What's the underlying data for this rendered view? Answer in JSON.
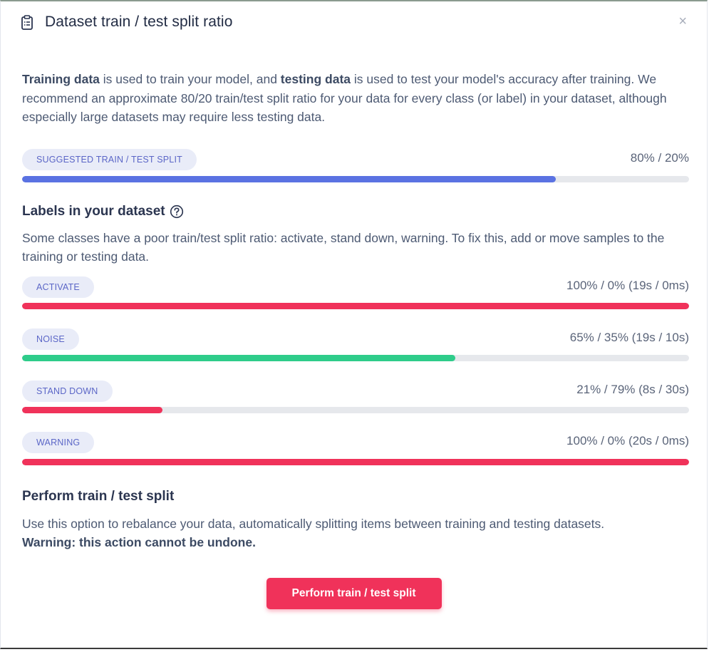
{
  "header": {
    "title": "Dataset train / test split ratio",
    "close_label": "×"
  },
  "intro": {
    "training_bold": "Training data",
    "text1": " is used to train your model, and ",
    "testing_bold": "testing data",
    "text2": " is used to test your model's accuracy after training. We recommend an approximate 80/20 train/test split ratio for your data for every class (or label) in your dataset, although especially large datasets may require less testing data."
  },
  "suggested": {
    "badge": "SUGGESTED TRAIN / TEST SPLIT",
    "ratio": "80% / 20%",
    "fill_fraction": 0.8,
    "color": "#5a72e2"
  },
  "labels_section": {
    "title": "Labels in your dataset",
    "description": "Some classes have a poor train/test split ratio: activate, stand down, warning. To fix this, add or move samples to the training or testing data.",
    "items": [
      {
        "label": "ACTIVATE",
        "ratio": "100% / 0% (19s / 0ms)",
        "fill_fraction": 1.0,
        "color": "#f0325a"
      },
      {
        "label": "NOISE",
        "ratio": "65% / 35% (19s / 10s)",
        "fill_fraction": 0.65,
        "color": "#2ecc8a"
      },
      {
        "label": "STAND DOWN",
        "ratio": "21% / 79% (8s / 30s)",
        "fill_fraction": 0.21,
        "color": "#f0325a"
      },
      {
        "label": "WARNING",
        "ratio": "100% / 0% (20s / 0ms)",
        "fill_fraction": 1.0,
        "color": "#f0325a"
      }
    ]
  },
  "perform_section": {
    "title": "Perform train / test split",
    "description": "Use this option to rebalance your data, automatically splitting items between training and testing datasets.",
    "warning": "Warning: this action cannot be undone.",
    "button_label": "Perform train / test split"
  },
  "icons": {
    "header": "clipboard-icon",
    "help": "question-circle-icon",
    "close": "close-icon"
  }
}
